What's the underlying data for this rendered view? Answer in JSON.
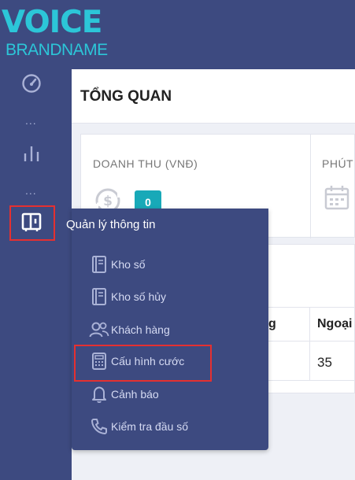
{
  "logo": {
    "line1": "VOICE",
    "line2": "BRANDNAME"
  },
  "sidebar": {
    "items": [
      {
        "icon": "dashboard-gauge-icon",
        "active": false
      },
      {
        "icon": "bar-chart-icon",
        "active": false
      },
      {
        "icon": "info-panel-icon",
        "active": true
      }
    ],
    "separator": "..."
  },
  "page": {
    "title": "TỔNG QUAN"
  },
  "stats": [
    {
      "label": "DOANH THU (VNĐ)",
      "badge": "0",
      "icon": "dollar-sync-icon"
    },
    {
      "label": "PHÚT",
      "icon": "calendar-icon"
    }
  ],
  "table": {
    "headers": [
      "g",
      "Ngoại"
    ],
    "row1": [
      "",
      "35"
    ]
  },
  "flyout": {
    "title": "Quản lý thông tin",
    "items": [
      {
        "label": "Kho số",
        "icon": "book-icon"
      },
      {
        "label": "Kho số hủy",
        "icon": "book-icon"
      },
      {
        "label": "Khách hàng",
        "icon": "users-icon"
      },
      {
        "label": "Cấu hình cước",
        "icon": "calculator-icon",
        "highlighted": true
      },
      {
        "label": "Cảnh báo",
        "icon": "bell-icon"
      },
      {
        "label": "Kiểm tra đầu số",
        "icon": "phone-icon"
      }
    ]
  },
  "colors": {
    "navy": "#3d4a80",
    "accent": "#2cc6d8",
    "badge": "#18a9b8",
    "highlight": "#e53030"
  }
}
